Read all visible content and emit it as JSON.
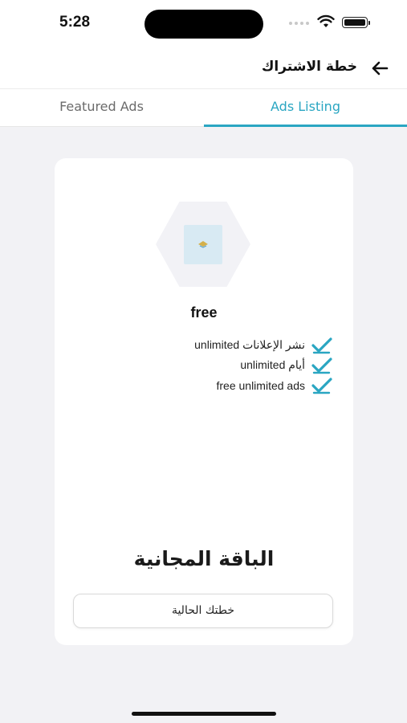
{
  "status_bar": {
    "time": "5:28",
    "icons": [
      "cellular-signal-icon",
      "wifi-icon",
      "battery-icon"
    ]
  },
  "header": {
    "title": "خطة الاشتراك",
    "back_icon": "arrow-left-icon"
  },
  "tabs": [
    {
      "label": "Featured Ads",
      "active": false
    },
    {
      "label": "Ads Listing",
      "active": true
    }
  ],
  "colors": {
    "accent": "#2aa6c2",
    "background": "#f2f2f5",
    "card": "#ffffff"
  },
  "plan_card": {
    "name": "free",
    "features": [
      {
        "text": "unlimited نشر الإعلانات",
        "icon": "check-icon"
      },
      {
        "text": "unlimited أيام",
        "icon": "check-icon"
      },
      {
        "text": "free unlimited ads",
        "icon": "check-icon"
      }
    ],
    "title": "الباقة المجانية",
    "button_label": "خطتك الحالية"
  }
}
